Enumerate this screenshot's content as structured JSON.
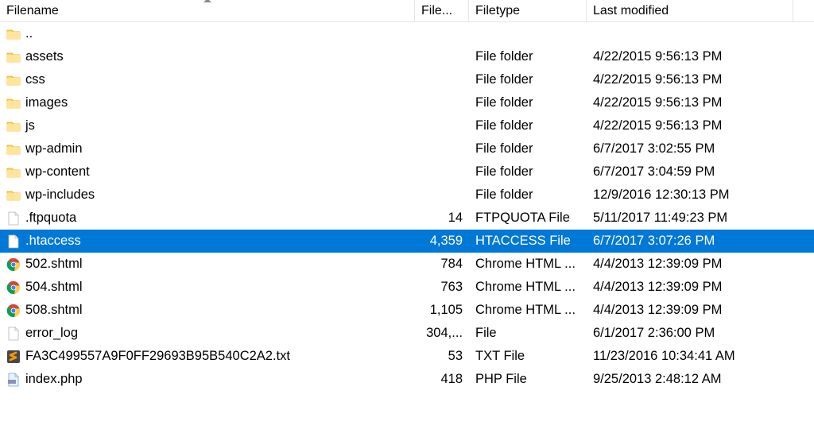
{
  "columns": {
    "name": "Filename",
    "size": "File...",
    "type": "Filetype",
    "date": "Last modified"
  },
  "sort_column": "name",
  "rows": [
    {
      "icon": "folder",
      "name": "..",
      "size": "",
      "type": "",
      "date": "",
      "selected": false
    },
    {
      "icon": "folder",
      "name": "assets",
      "size": "",
      "type": "File folder",
      "date": "4/22/2015 9:56:13 PM",
      "selected": false
    },
    {
      "icon": "folder",
      "name": "css",
      "size": "",
      "type": "File folder",
      "date": "4/22/2015 9:56:13 PM",
      "selected": false
    },
    {
      "icon": "folder",
      "name": "images",
      "size": "",
      "type": "File folder",
      "date": "4/22/2015 9:56:13 PM",
      "selected": false
    },
    {
      "icon": "folder",
      "name": "js",
      "size": "",
      "type": "File folder",
      "date": "4/22/2015 9:56:13 PM",
      "selected": false
    },
    {
      "icon": "folder",
      "name": "wp-admin",
      "size": "",
      "type": "File folder",
      "date": "6/7/2017 3:02:55 PM",
      "selected": false
    },
    {
      "icon": "folder",
      "name": "wp-content",
      "size": "",
      "type": "File folder",
      "date": "6/7/2017 3:04:59 PM",
      "selected": false
    },
    {
      "icon": "folder",
      "name": "wp-includes",
      "size": "",
      "type": "File folder",
      "date": "12/9/2016 12:30:13 PM",
      "selected": false
    },
    {
      "icon": "file",
      "name": ".ftpquota",
      "size": "14",
      "type": "FTPQUOTA File",
      "date": "5/11/2017 11:49:23 PM",
      "selected": false
    },
    {
      "icon": "file",
      "name": ".htaccess",
      "size": "4,359",
      "type": "HTACCESS File",
      "date": "6/7/2017 3:07:26 PM",
      "selected": true
    },
    {
      "icon": "chrome",
      "name": "502.shtml",
      "size": "784",
      "type": "Chrome HTML ...",
      "date": "4/4/2013 12:39:09 PM",
      "selected": false
    },
    {
      "icon": "chrome",
      "name": "504.shtml",
      "size": "763",
      "type": "Chrome HTML ...",
      "date": "4/4/2013 12:39:09 PM",
      "selected": false
    },
    {
      "icon": "chrome",
      "name": "508.shtml",
      "size": "1,105",
      "type": "Chrome HTML ...",
      "date": "4/4/2013 12:39:09 PM",
      "selected": false
    },
    {
      "icon": "file",
      "name": "error_log",
      "size": "304,...",
      "type": "File",
      "date": "6/1/2017 2:36:00 PM",
      "selected": false
    },
    {
      "icon": "sublime",
      "name": "FA3C499557A9F0FF29693B95B540C2A2.txt",
      "size": "53",
      "type": "TXT File",
      "date": "11/23/2016 10:34:41 AM",
      "selected": false
    },
    {
      "icon": "php",
      "name": "index.php",
      "size": "418",
      "type": "PHP File",
      "date": "9/25/2013 2:48:12 AM",
      "selected": false
    }
  ]
}
